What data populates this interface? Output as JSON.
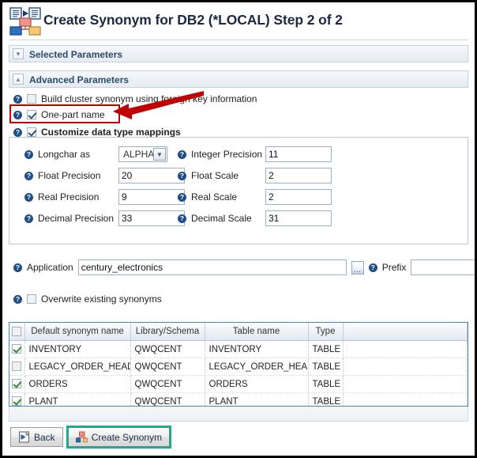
{
  "window": {
    "title": "Create Synonym for DB2 (*LOCAL) Step 2 of 2",
    "title_icon": "synonym-mapping-icon"
  },
  "sections": {
    "selected": {
      "label": "Selected Parameters",
      "chevron": "chevron-down-icon",
      "expanded": false
    },
    "advanced": {
      "label": "Advanced Parameters",
      "chevron": "chevron-up-icon",
      "expanded": true
    }
  },
  "options": {
    "build_cluster": {
      "label": "Build cluster synonym using foreign key information",
      "checked": false
    },
    "one_part_name": {
      "label": "One-part name",
      "checked": true,
      "highlighted": true
    },
    "customize_mappings": {
      "label": "Customize data type mappings",
      "checked": true
    },
    "overwrite_existing": {
      "label": "Overwrite existing synonyms",
      "checked": false
    }
  },
  "mappings": {
    "longchar_as": {
      "label": "Longchar as",
      "value": "ALPHA",
      "type": "select"
    },
    "integer_precision": {
      "label": "Integer Precision",
      "value": "11"
    },
    "float_precision": {
      "label": "Float Precision",
      "value": "20"
    },
    "float_scale": {
      "label": "Float Scale",
      "value": "2"
    },
    "real_precision": {
      "label": "Real  Precision",
      "value": "9"
    },
    "real_scale": {
      "label": "Real  Scale",
      "value": "2"
    },
    "decimal_precision": {
      "label": "Decimal Precision",
      "value": "33"
    },
    "decimal_scale": {
      "label": "Decimal Scale",
      "value": "31"
    }
  },
  "application": {
    "label": "Application",
    "value": "century_electronics",
    "browse_label": "...",
    "prefix_label": "Prefix",
    "prefix_value": ""
  },
  "table": {
    "columns": [
      "",
      "Default synonym name",
      "Library/Schema",
      "Table name",
      "Type",
      ""
    ],
    "rows": [
      {
        "checked": true,
        "synonym": "INVENTORY",
        "library": "QWQCENT",
        "table": "INVENTORY",
        "type": "TABLE"
      },
      {
        "checked": false,
        "synonym": "LEGACY_ORDER_HEADER",
        "library": "QWQCENT",
        "table": "LEGACY_ORDER_HEADER",
        "type": "TABLE"
      },
      {
        "checked": true,
        "synonym": "ORDERS",
        "library": "QWQCENT",
        "table": "ORDERS",
        "type": "TABLE"
      },
      {
        "checked": true,
        "synonym": "PLANT",
        "library": "QWQCENT",
        "table": "PLANT",
        "type": "TABLE"
      }
    ]
  },
  "buttons": {
    "back": {
      "label": "Back",
      "icon": "page-back-icon",
      "focused": false
    },
    "create": {
      "label": "Create Synonym",
      "icon": "synonym-mapping-icon",
      "focused": true
    }
  },
  "annotation": {
    "highlight_target": "One-part name",
    "arrow": "left-arrow",
    "color": "#c00000"
  },
  "colors": {
    "accent": "#2d4a6b",
    "help_icon": "#1f4e87",
    "check": "#2f8f2f",
    "annotation": "#c00000",
    "focus": "#00b894",
    "table_border": "#4a86b8"
  },
  "icons": {
    "help": "?",
    "chevron_down": "ˇ",
    "chevron_up": "ˆ"
  }
}
